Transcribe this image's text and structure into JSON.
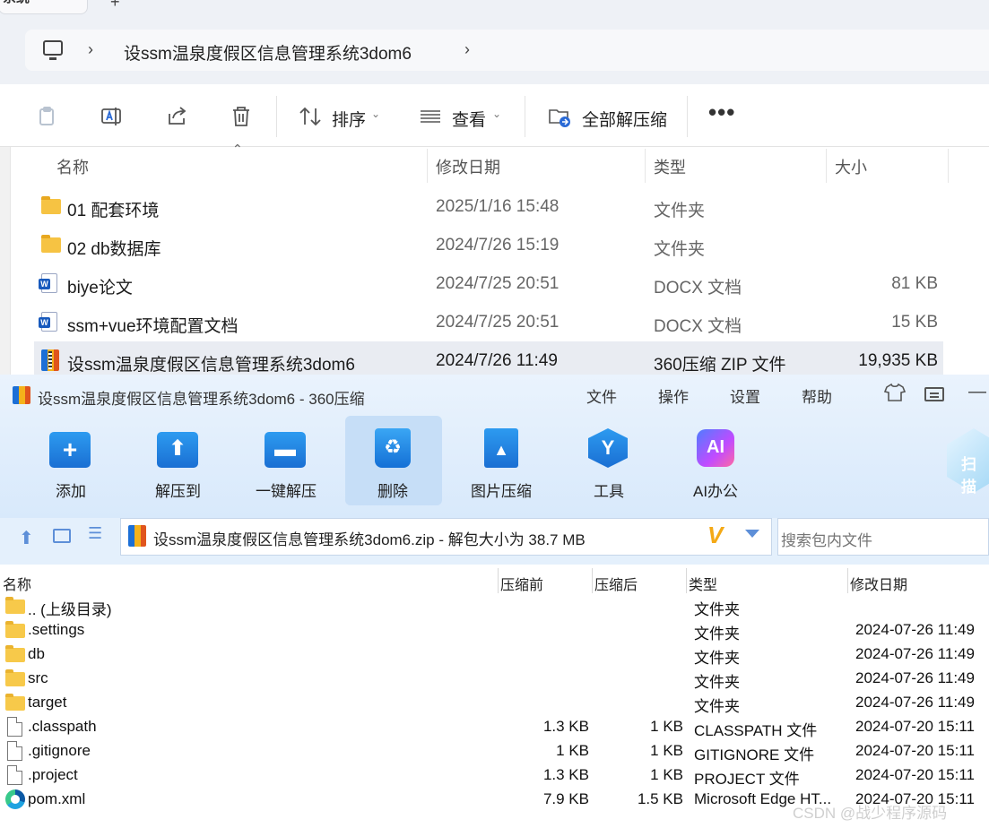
{
  "explorer": {
    "tab_title": "系统",
    "tab_close": "×",
    "new_tab": "+",
    "breadcrumb": [
      "设ssm温泉度假区信息管理系统3dom6"
    ],
    "toolbar": {
      "sort_label": "排序",
      "view_label": "查看",
      "extract_all_label": "全部解压缩",
      "more_label": "..."
    },
    "columns": [
      "名称",
      "修改日期",
      "类型",
      "大小"
    ],
    "files": [
      {
        "name": "01 配套环境",
        "date": "2025/1/16 15:48",
        "type": "文件夹",
        "size": "",
        "icon": "folder"
      },
      {
        "name": "02 db数据库",
        "date": "2024/7/26 15:19",
        "type": "文件夹",
        "size": "",
        "icon": "folder"
      },
      {
        "name": "biye论文",
        "date": "2024/7/25 20:51",
        "type": "DOCX 文档",
        "size": "81 KB",
        "icon": "word"
      },
      {
        "name": "ssm+vue环境配置文档",
        "date": "2024/7/25 20:51",
        "type": "DOCX 文档",
        "size": "15 KB",
        "icon": "word"
      },
      {
        "name": "设ssm温泉度假区信息管理系统3dom6",
        "date": "2024/7/26 11:49",
        "type": "360压缩 ZIP 文件",
        "size": "19,935 KB",
        "icon": "zip",
        "selected": true
      }
    ]
  },
  "zip": {
    "window_title": "设ssm温泉度假区信息管理系统3dom6 - 360压缩",
    "menu": [
      "文件",
      "操作",
      "设置",
      "帮助"
    ],
    "tools": [
      {
        "label": "添加",
        "icon": "add-folder-icon"
      },
      {
        "label": "解压到",
        "icon": "extract-to-icon"
      },
      {
        "label": "一键解压",
        "icon": "one-click-extract-icon"
      },
      {
        "label": "删除",
        "icon": "recycle-delete-icon",
        "active": true
      },
      {
        "label": "图片压缩",
        "icon": "image-compress-icon"
      },
      {
        "label": "工具",
        "icon": "tools-icon"
      },
      {
        "label": "AI办公",
        "icon": "ai-office-icon"
      }
    ],
    "ai_glyph": "AI",
    "scan_label": "扫描",
    "path_text": "设ssm温泉度假区信息管理系统3dom6.zip - 解包大小为 38.7 MB",
    "search_placeholder": "搜索包内文件",
    "columns": [
      "名称",
      "压缩前",
      "压缩后",
      "类型",
      "修改日期"
    ],
    "entries": [
      {
        "name": ".. (上级目录)",
        "before": "",
        "after": "",
        "type": "文件夹",
        "date": "",
        "icon": "folder"
      },
      {
        "name": ".settings",
        "before": "",
        "after": "",
        "type": "文件夹",
        "date": "2024-07-26 11:49",
        "icon": "folder"
      },
      {
        "name": "db",
        "before": "",
        "after": "",
        "type": "文件夹",
        "date": "2024-07-26 11:49",
        "icon": "folder"
      },
      {
        "name": "src",
        "before": "",
        "after": "",
        "type": "文件夹",
        "date": "2024-07-26 11:49",
        "icon": "folder"
      },
      {
        "name": "target",
        "before": "",
        "after": "",
        "type": "文件夹",
        "date": "2024-07-26 11:49",
        "icon": "folder"
      },
      {
        "name": ".classpath",
        "before": "1.3 KB",
        "after": "1 KB",
        "type": "CLASSPATH 文件",
        "date": "2024-07-20 15:11",
        "icon": "file"
      },
      {
        "name": ".gitignore",
        "before": "1 KB",
        "after": "1 KB",
        "type": "GITIGNORE 文件",
        "date": "2024-07-20 15:11",
        "icon": "file"
      },
      {
        "name": ".project",
        "before": "1.3 KB",
        "after": "1 KB",
        "type": "PROJECT 文件",
        "date": "2024-07-20 15:11",
        "icon": "file"
      },
      {
        "name": "pom.xml",
        "before": "7.9 KB",
        "after": "1.5 KB",
        "type": "Microsoft Edge HT...",
        "date": "2024-07-20 15:11",
        "icon": "edge"
      }
    ]
  },
  "watermark": "CSDN @战少程序源码"
}
